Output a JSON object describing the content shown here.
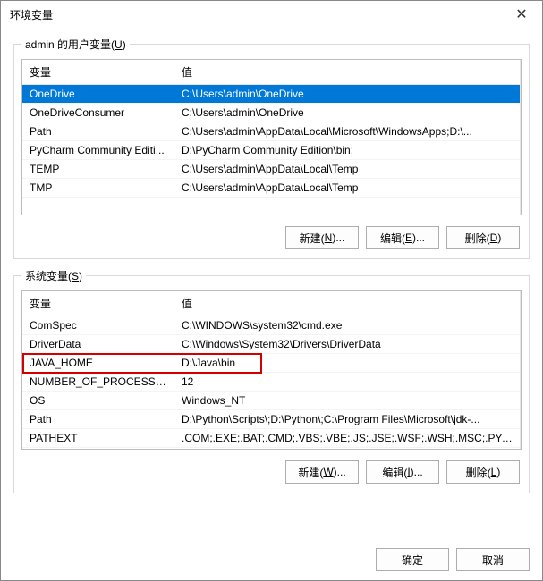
{
  "title": "环境变量",
  "userGroup": {
    "legend_prefix": "admin 的用户变量(",
    "legend_hotkey": "U",
    "legend_suffix": ")",
    "headers": {
      "name": "变量",
      "value": "值"
    },
    "rows": [
      {
        "name": "OneDrive",
        "value": "C:\\Users\\admin\\OneDrive",
        "selected": true
      },
      {
        "name": "OneDriveConsumer",
        "value": "C:\\Users\\admin\\OneDrive"
      },
      {
        "name": "Path",
        "value": "C:\\Users\\admin\\AppData\\Local\\Microsoft\\WindowsApps;D:\\..."
      },
      {
        "name": "PyCharm Community Editi...",
        "value": "D:\\PyCharm Community Edition\\bin;"
      },
      {
        "name": "TEMP",
        "value": "C:\\Users\\admin\\AppData\\Local\\Temp"
      },
      {
        "name": "TMP",
        "value": "C:\\Users\\admin\\AppData\\Local\\Temp"
      }
    ],
    "buttons": {
      "new_prefix": "新建(",
      "new_hotkey": "N",
      "new_suffix": ")...",
      "edit_prefix": "编辑(",
      "edit_hotkey": "E",
      "edit_suffix": ")...",
      "del_prefix": "删除(",
      "del_hotkey": "D",
      "del_suffix": ")"
    }
  },
  "sysGroup": {
    "legend_prefix": "系统变量(",
    "legend_hotkey": "S",
    "legend_suffix": ")",
    "headers": {
      "name": "变量",
      "value": "值"
    },
    "rows": [
      {
        "name": "ComSpec",
        "value": "C:\\WINDOWS\\system32\\cmd.exe"
      },
      {
        "name": "DriverData",
        "value": "C:\\Windows\\System32\\Drivers\\DriverData"
      },
      {
        "name": "JAVA_HOME",
        "value": "D:\\Java\\bin",
        "highlight": true
      },
      {
        "name": "NUMBER_OF_PROCESSORS",
        "value": "12"
      },
      {
        "name": "OS",
        "value": "Windows_NT"
      },
      {
        "name": "Path",
        "value": "D:\\Python\\Scripts\\;D:\\Python\\;C:\\Program Files\\Microsoft\\jdk-..."
      },
      {
        "name": "PATHEXT",
        "value": ".COM;.EXE;.BAT;.CMD;.VBS;.VBE;.JS;.JSE;.WSF;.WSH;.MSC;.PY;.P..."
      }
    ],
    "buttons": {
      "new_prefix": "新建(",
      "new_hotkey": "W",
      "new_suffix": ")...",
      "edit_prefix": "编辑(",
      "edit_hotkey": "I",
      "edit_suffix": ")...",
      "del_prefix": "删除(",
      "del_hotkey": "L",
      "del_suffix": ")"
    }
  },
  "footer": {
    "ok": "确定",
    "cancel": "取消"
  }
}
